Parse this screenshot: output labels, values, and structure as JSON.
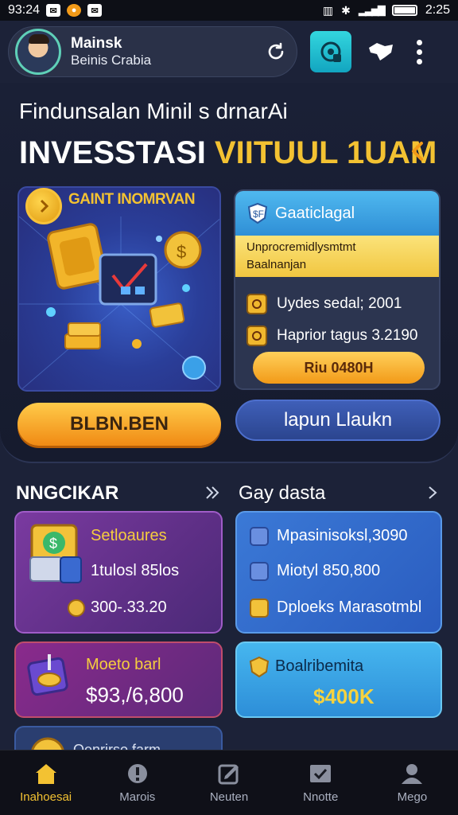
{
  "status_bar": {
    "time_left": "93:24",
    "time_right": "2:25"
  },
  "header": {
    "profile_name": "Mainsk",
    "profile_subtitle": "Beinis Crabia"
  },
  "hero": {
    "subtitle": "Findunsalan Minil s drnarAi",
    "title_white": "INVESSTASI",
    "title_yellow": "VIITUUL 1UAM"
  },
  "promo_card": {
    "title": "GAINT INOMRVAN"
  },
  "info_card": {
    "title": "Gaaticlagal",
    "banner_line1": "Unprocremidlysmtmt",
    "banner_line2": "Baalnanjan",
    "rows": [
      {
        "label": "Uydes sedal; 2001"
      },
      {
        "label": "Haprior tagus 3.2190"
      }
    ],
    "button_label": "Riu 0480H"
  },
  "actions": {
    "primary_label": "BLBN.BEN",
    "secondary_label": "lapun Llaukn"
  },
  "section_left": {
    "title": "NNGCIKAR",
    "card1": {
      "title": "Setloaures",
      "line1": "1tulosl 85los",
      "line2": "300-.33.20"
    },
    "card2": {
      "title": "Moeto barl",
      "value": "$93,/6,800"
    },
    "partial_label": "Qenrirso farm"
  },
  "section_right": {
    "title": "Gay dasta",
    "card1": {
      "rows": [
        {
          "label": "Mpasinisoksl,3090"
        },
        {
          "label": "Miotyl 850,800"
        },
        {
          "label": "Dploeks Marasotmbl"
        }
      ]
    },
    "card2": {
      "title": "Boalribemita",
      "value": "$400K"
    }
  },
  "bottom_nav": {
    "items": [
      {
        "label": "Inahoesai",
        "icon": "home-icon",
        "active": true
      },
      {
        "label": "Marois",
        "icon": "alert-icon",
        "active": false
      },
      {
        "label": "Neuten",
        "icon": "edit-icon",
        "active": false
      },
      {
        "label": "Nnotte",
        "icon": "check-icon",
        "active": false
      },
      {
        "label": "Mego",
        "icon": "user-icon",
        "active": false
      }
    ]
  },
  "colors": {
    "accent_yellow": "#f3c232",
    "accent_orange": "#f29a18",
    "background": "#1c2238",
    "teal": "#22c0d0"
  }
}
